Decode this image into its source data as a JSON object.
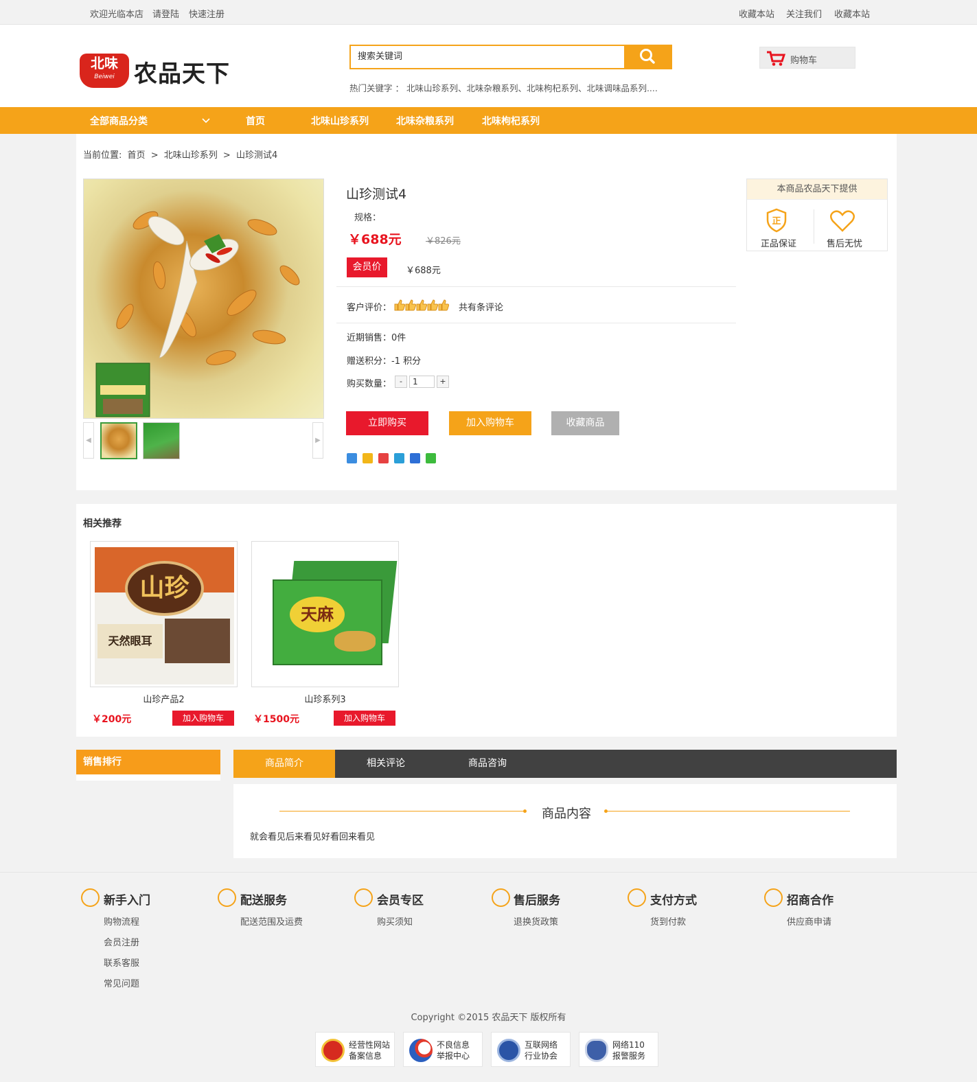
{
  "topbar": {
    "welcome": "欢迎光临本店",
    "login": "请登陆",
    "register": "快速注册",
    "fav1": "收藏本站",
    "follow": "关注我们",
    "fav2": "收藏本站"
  },
  "logo": {
    "badge_cn": "北味",
    "badge_en": "Beiwei",
    "brand": "农品天下"
  },
  "search": {
    "placeholder": "搜索关键词",
    "hotkeys": "热门关键字 ： 北味山珍系列、北味杂粮系列、北味枸杞系列、北味调味品系列...."
  },
  "cart": {
    "label": "购物车"
  },
  "nav": {
    "all_categories": "全部商品分类",
    "items": [
      "首页",
      "北味山珍系列",
      "北味杂粮系列",
      "北味枸杞系列"
    ]
  },
  "breadcrumb": {
    "prefix": "当前位置:",
    "home": "首页",
    "sep1": ">",
    "category": "北味山珍系列",
    "sep2": ">",
    "current": "山珍测试4"
  },
  "product": {
    "title": "山珍测试4",
    "spec_label": "规格：",
    "price": "￥688元",
    "original_price": "￥826元",
    "member_label": "会员价",
    "member_price": "￥688元",
    "review_label": "客户评价：",
    "review_count": "共有条评论",
    "sales_label": "近期销售：0件",
    "points_label": "赠送积分：-1 积分",
    "qty_label": "购买数量：",
    "qty_minus": "-",
    "qty_value": "1",
    "qty_plus": "+",
    "buy_now": "立即购买",
    "add_cart": "加入购物车",
    "favorite": "收藏商品",
    "rating": 5
  },
  "provider": {
    "heading": "本商品农品天下提供",
    "genuine_icon_text": "正",
    "genuine": "正品保证",
    "aftersale": "售后无忧"
  },
  "related": {
    "title": "相关推荐",
    "items": [
      {
        "name": "山珍产品2",
        "price": "￥200元",
        "button": "加入购物车",
        "box_text": "山珍",
        "box_sub": "天然眼耳"
      },
      {
        "name": "山珍系列3",
        "price": "￥1500元",
        "button": "加入购物车",
        "box_text": "天麻"
      }
    ]
  },
  "sales_rank": {
    "title": "销售排行"
  },
  "tabs": {
    "items": [
      "商品简介",
      "相关评论",
      "商品咨询"
    ],
    "active": 0,
    "content_title": "商品内容",
    "content_text": "就会看见后来看见好看回来看见"
  },
  "footer": {
    "columns": [
      {
        "title": "新手入门",
        "items": [
          "购物流程",
          "会员注册",
          "联系客服",
          "常见问题"
        ]
      },
      {
        "title": "配送服务",
        "items": [
          "配送范围及运费"
        ]
      },
      {
        "title": "会员专区",
        "items": [
          "购买须知"
        ]
      },
      {
        "title": "售后服务",
        "items": [
          "退换货政策"
        ]
      },
      {
        "title": "支付方式",
        "items": [
          "货到付款"
        ]
      },
      {
        "title": "招商合作",
        "items": [
          "供应商申请"
        ]
      }
    ],
    "copyright": "Copyright ©2015 农品天下 版权所有",
    "certs": [
      {
        "line1": "经营性网站",
        "line2": "备案信息"
      },
      {
        "line1": "不良信息",
        "line2": "举报中心"
      },
      {
        "line1": "互联网络",
        "line2": "行业协会"
      },
      {
        "line1": "网络110",
        "line2": "报警服务"
      }
    ]
  },
  "colors": {
    "accent": "#f5a319",
    "red": "#e8192c",
    "dark_tab": "#414141",
    "gray_button": "#b0b0b0"
  }
}
